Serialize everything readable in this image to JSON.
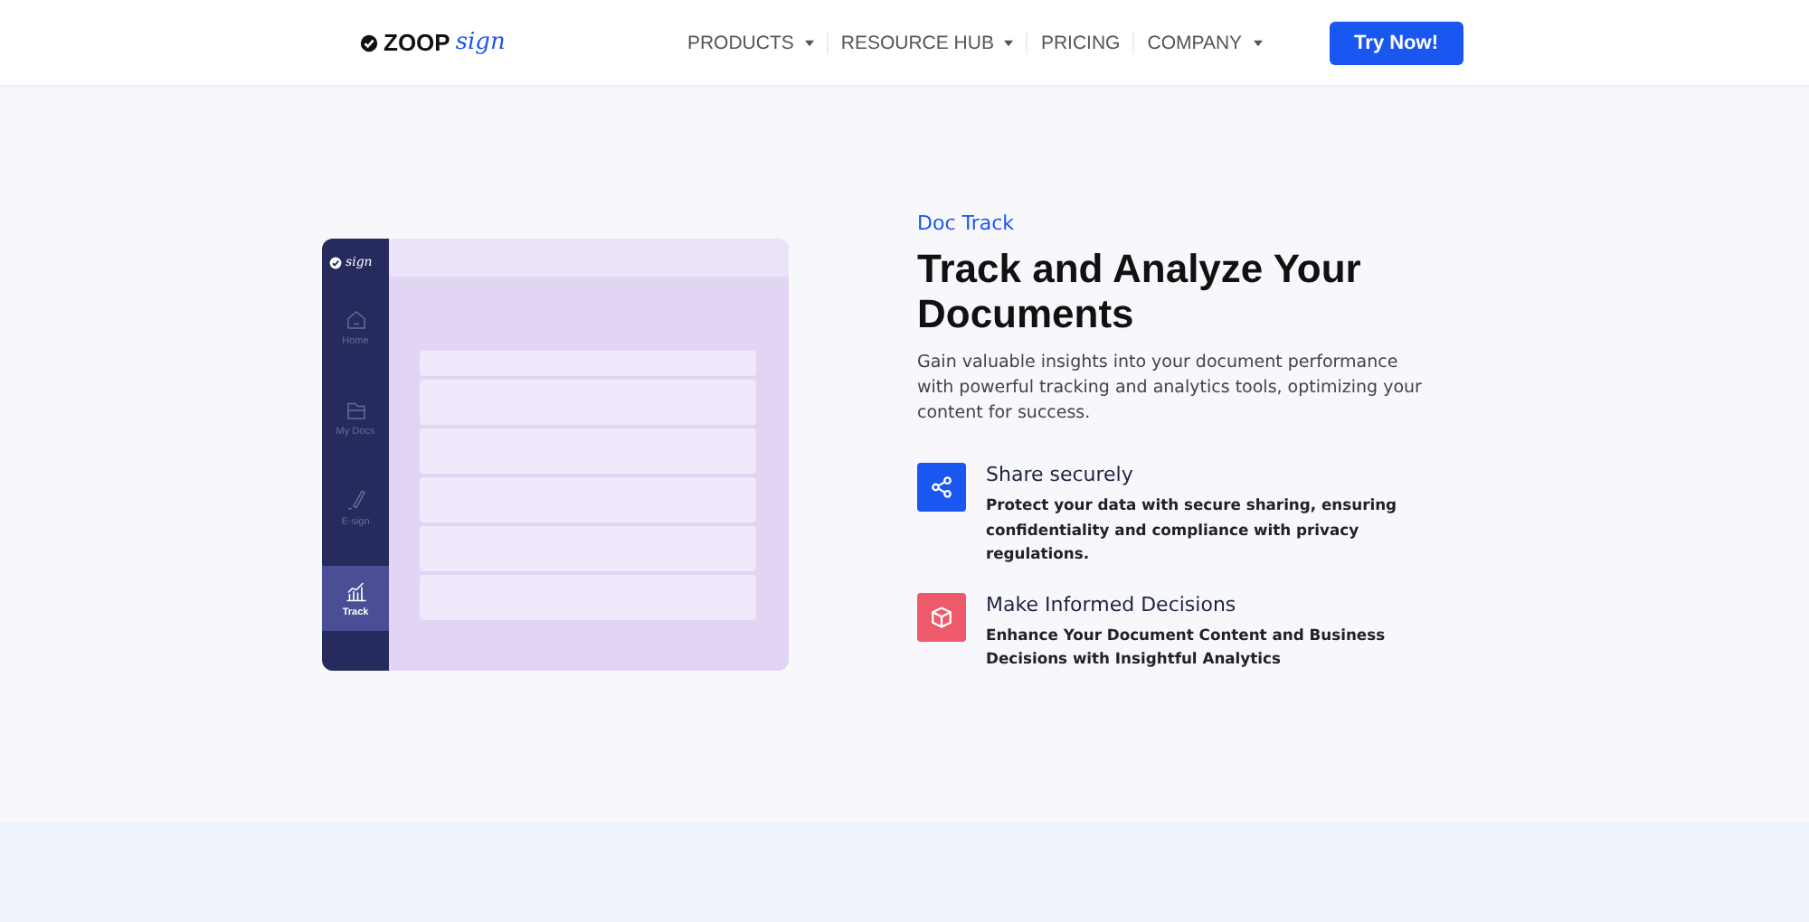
{
  "header": {
    "logo": {
      "bold": "ZOOP",
      "script": "sign"
    },
    "nav": [
      {
        "label": "PRODUCTS",
        "dropdown": true
      },
      {
        "label": "RESOURCE HUB",
        "dropdown": true
      },
      {
        "label": "PRICING",
        "dropdown": false
      },
      {
        "label": "COMPANY",
        "dropdown": true
      }
    ],
    "cta": "Try Now!"
  },
  "mockup": {
    "logo": "sign",
    "sidebar": [
      {
        "label": "Home",
        "kind": "home",
        "selected": false
      },
      {
        "label": "My Docs",
        "kind": "folder",
        "selected": false
      },
      {
        "label": "E-sign",
        "kind": "pen",
        "selected": false
      },
      {
        "label": "Track",
        "kind": "chart",
        "selected": true
      }
    ]
  },
  "content": {
    "eyebrow": "Doc Track",
    "title": "Track and Analyze Your Documents",
    "description": "Gain valuable insights into your document performance with powerful tracking and analytics tools, optimizing your content for success.",
    "features": [
      {
        "kind": "share",
        "color": "#1a56f0",
        "title": "Share securely",
        "text": "Protect your data with secure sharing, ensuring confidentiality and compliance with privacy regulations."
      },
      {
        "kind": "box",
        "color": "#ef5a6a",
        "title": "Make Informed Decisions",
        "text": "Enhance Your Document Content and Business Decisions with Insightful Analytics"
      }
    ]
  }
}
